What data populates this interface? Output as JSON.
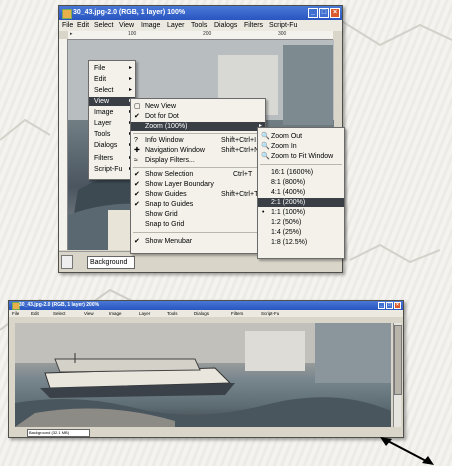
{
  "window1": {
    "title": "30_43.jpg-2.0 (RGB, 1 layer) 100%",
    "menubar": [
      "File",
      "Edit",
      "Select",
      "View",
      "Image",
      "Layer",
      "Tools",
      "Dialogs",
      "Filters",
      "Script-Fu"
    ],
    "status_layer": "Background",
    "ruler_marks": [
      "100",
      "200",
      "300"
    ]
  },
  "context_menu": {
    "items": [
      "File",
      "Edit",
      "Select",
      "View",
      "Image",
      "Layer",
      "Tools",
      "Dialogs",
      "Filters",
      "Script-Fu"
    ],
    "selected": "View"
  },
  "view_menu": {
    "items": [
      {
        "label": "New View",
        "shortcut": "",
        "check": false,
        "icon": "new-view-icon"
      },
      {
        "label": "Dot for Dot",
        "shortcut": "",
        "check": true,
        "icon": ""
      },
      {
        "label": "Zoom (100%)",
        "shortcut": "",
        "check": false,
        "icon": "",
        "selected": true,
        "submenu": true
      },
      {
        "label": "Info Window",
        "shortcut": "Shift+Ctrl+I",
        "check": false,
        "icon": "info-icon"
      },
      {
        "label": "Navigation Window",
        "shortcut": "Shift+Ctrl+N",
        "check": false,
        "icon": "navigation-icon"
      },
      {
        "label": "Display Filters...",
        "shortcut": "",
        "check": false,
        "icon": "display-filters-icon"
      },
      {
        "label": "Show Selection",
        "shortcut": "Ctrl+T",
        "check": true,
        "icon": ""
      },
      {
        "label": "Show Layer Boundary",
        "shortcut": "",
        "check": true,
        "icon": ""
      },
      {
        "label": "Show Guides",
        "shortcut": "Shift+Ctrl+T",
        "check": true,
        "icon": ""
      },
      {
        "label": "Snap to Guides",
        "shortcut": "",
        "check": true,
        "icon": ""
      },
      {
        "label": "Show Grid",
        "shortcut": "",
        "check": false,
        "icon": ""
      },
      {
        "label": "Snap to Grid",
        "shortcut": "",
        "check": false,
        "icon": ""
      },
      {
        "label": "Show Menubar",
        "shortcut": "",
        "check": true,
        "icon": ""
      }
    ]
  },
  "zoom_menu": {
    "actions": [
      "Zoom Out",
      "Zoom In",
      "Zoom to Fit Window"
    ],
    "levels": [
      "16:1  (1600%)",
      "8:1  (800%)",
      "4:1  (400%)",
      "2:1  (200%)",
      "1:1  (100%)",
      "1:2  (50%)",
      "1:4  (25%)",
      "1:8  (12.5%)"
    ],
    "selected": "2:1  (200%)",
    "current": "1:1  (100%)"
  },
  "window2": {
    "title": "30_43.jpg-2.0 (RGB, 1 layer) 200%",
    "menubar": [
      "File",
      "Edit",
      "Select",
      "View",
      "Image",
      "Layer",
      "Tools",
      "Dialogs",
      "Filters",
      "Script-Fu"
    ],
    "status_layer": "Background (32.1 MB)"
  }
}
